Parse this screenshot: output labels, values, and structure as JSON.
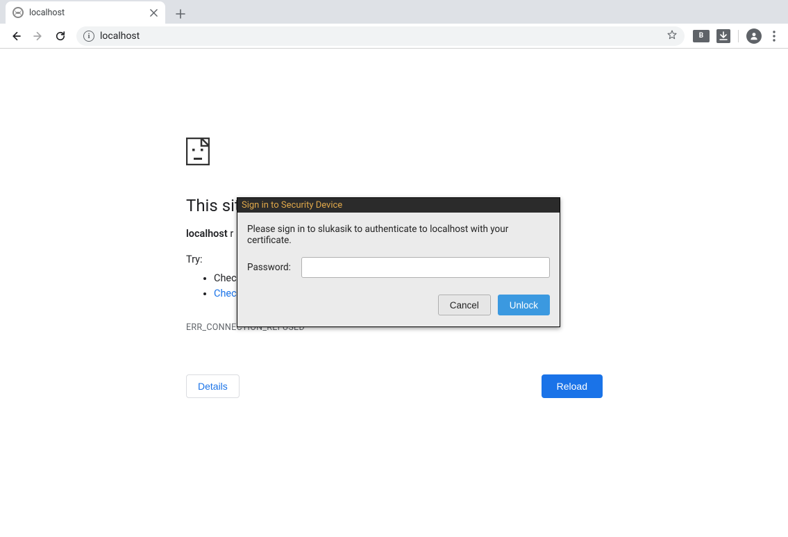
{
  "tab": {
    "title": "localhost"
  },
  "toolbar": {
    "url": "localhost"
  },
  "error_page": {
    "heading_visible": "This sit",
    "sub_bold": "localhost",
    "sub_rest_visible": " r",
    "try_label": "Try:",
    "list_item1_visible": "Chec",
    "list_item2_visible": "Chec",
    "error_code": "ERR_CONNECTION_REFUSED",
    "details_button": "Details",
    "reload_button": "Reload"
  },
  "dialog": {
    "title": "Sign in to Security Device",
    "message": "Please sign in to slukasik to authenticate to localhost with your certificate.",
    "password_label": "Password:",
    "cancel": "Cancel",
    "unlock": "Unlock"
  },
  "extensions": {
    "ext1_label": "B"
  }
}
